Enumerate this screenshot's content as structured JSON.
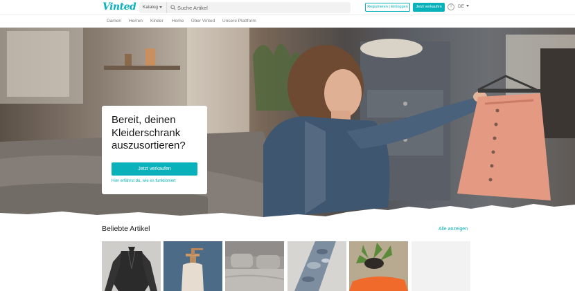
{
  "header": {
    "logo": "Vinted",
    "catalog_label": "Katalog",
    "search_placeholder": "Suche Artikel",
    "register_label": "Registrieren | Einloggen",
    "sell_label": "Jetzt verkaufen",
    "help_glyph": "?",
    "language": "DE"
  },
  "nav": {
    "items": [
      "Damen",
      "Herren",
      "Kinder",
      "Home",
      "Über Vinted",
      "Unsere Plattform"
    ]
  },
  "hero": {
    "title": "Bereit, deinen Kleiderschrank auszusortieren?",
    "button_label": "Jetzt verkaufen",
    "link_label": "Hier erfährst du, wie es funktioniert"
  },
  "popular": {
    "title": "Beliebte Artikel",
    "see_all_label": "Alle anzeigen",
    "products": [
      {
        "icon": "black-blouse-image"
      },
      {
        "icon": "soap-dispenser-image"
      },
      {
        "icon": "bedding-image"
      },
      {
        "icon": "camouflage-pants-image"
      },
      {
        "icon": "plant-and-orange-item-image"
      },
      {
        "icon": "placeholder-image"
      }
    ]
  },
  "colors": {
    "brand": "#09b1ba",
    "text": "#171717"
  }
}
